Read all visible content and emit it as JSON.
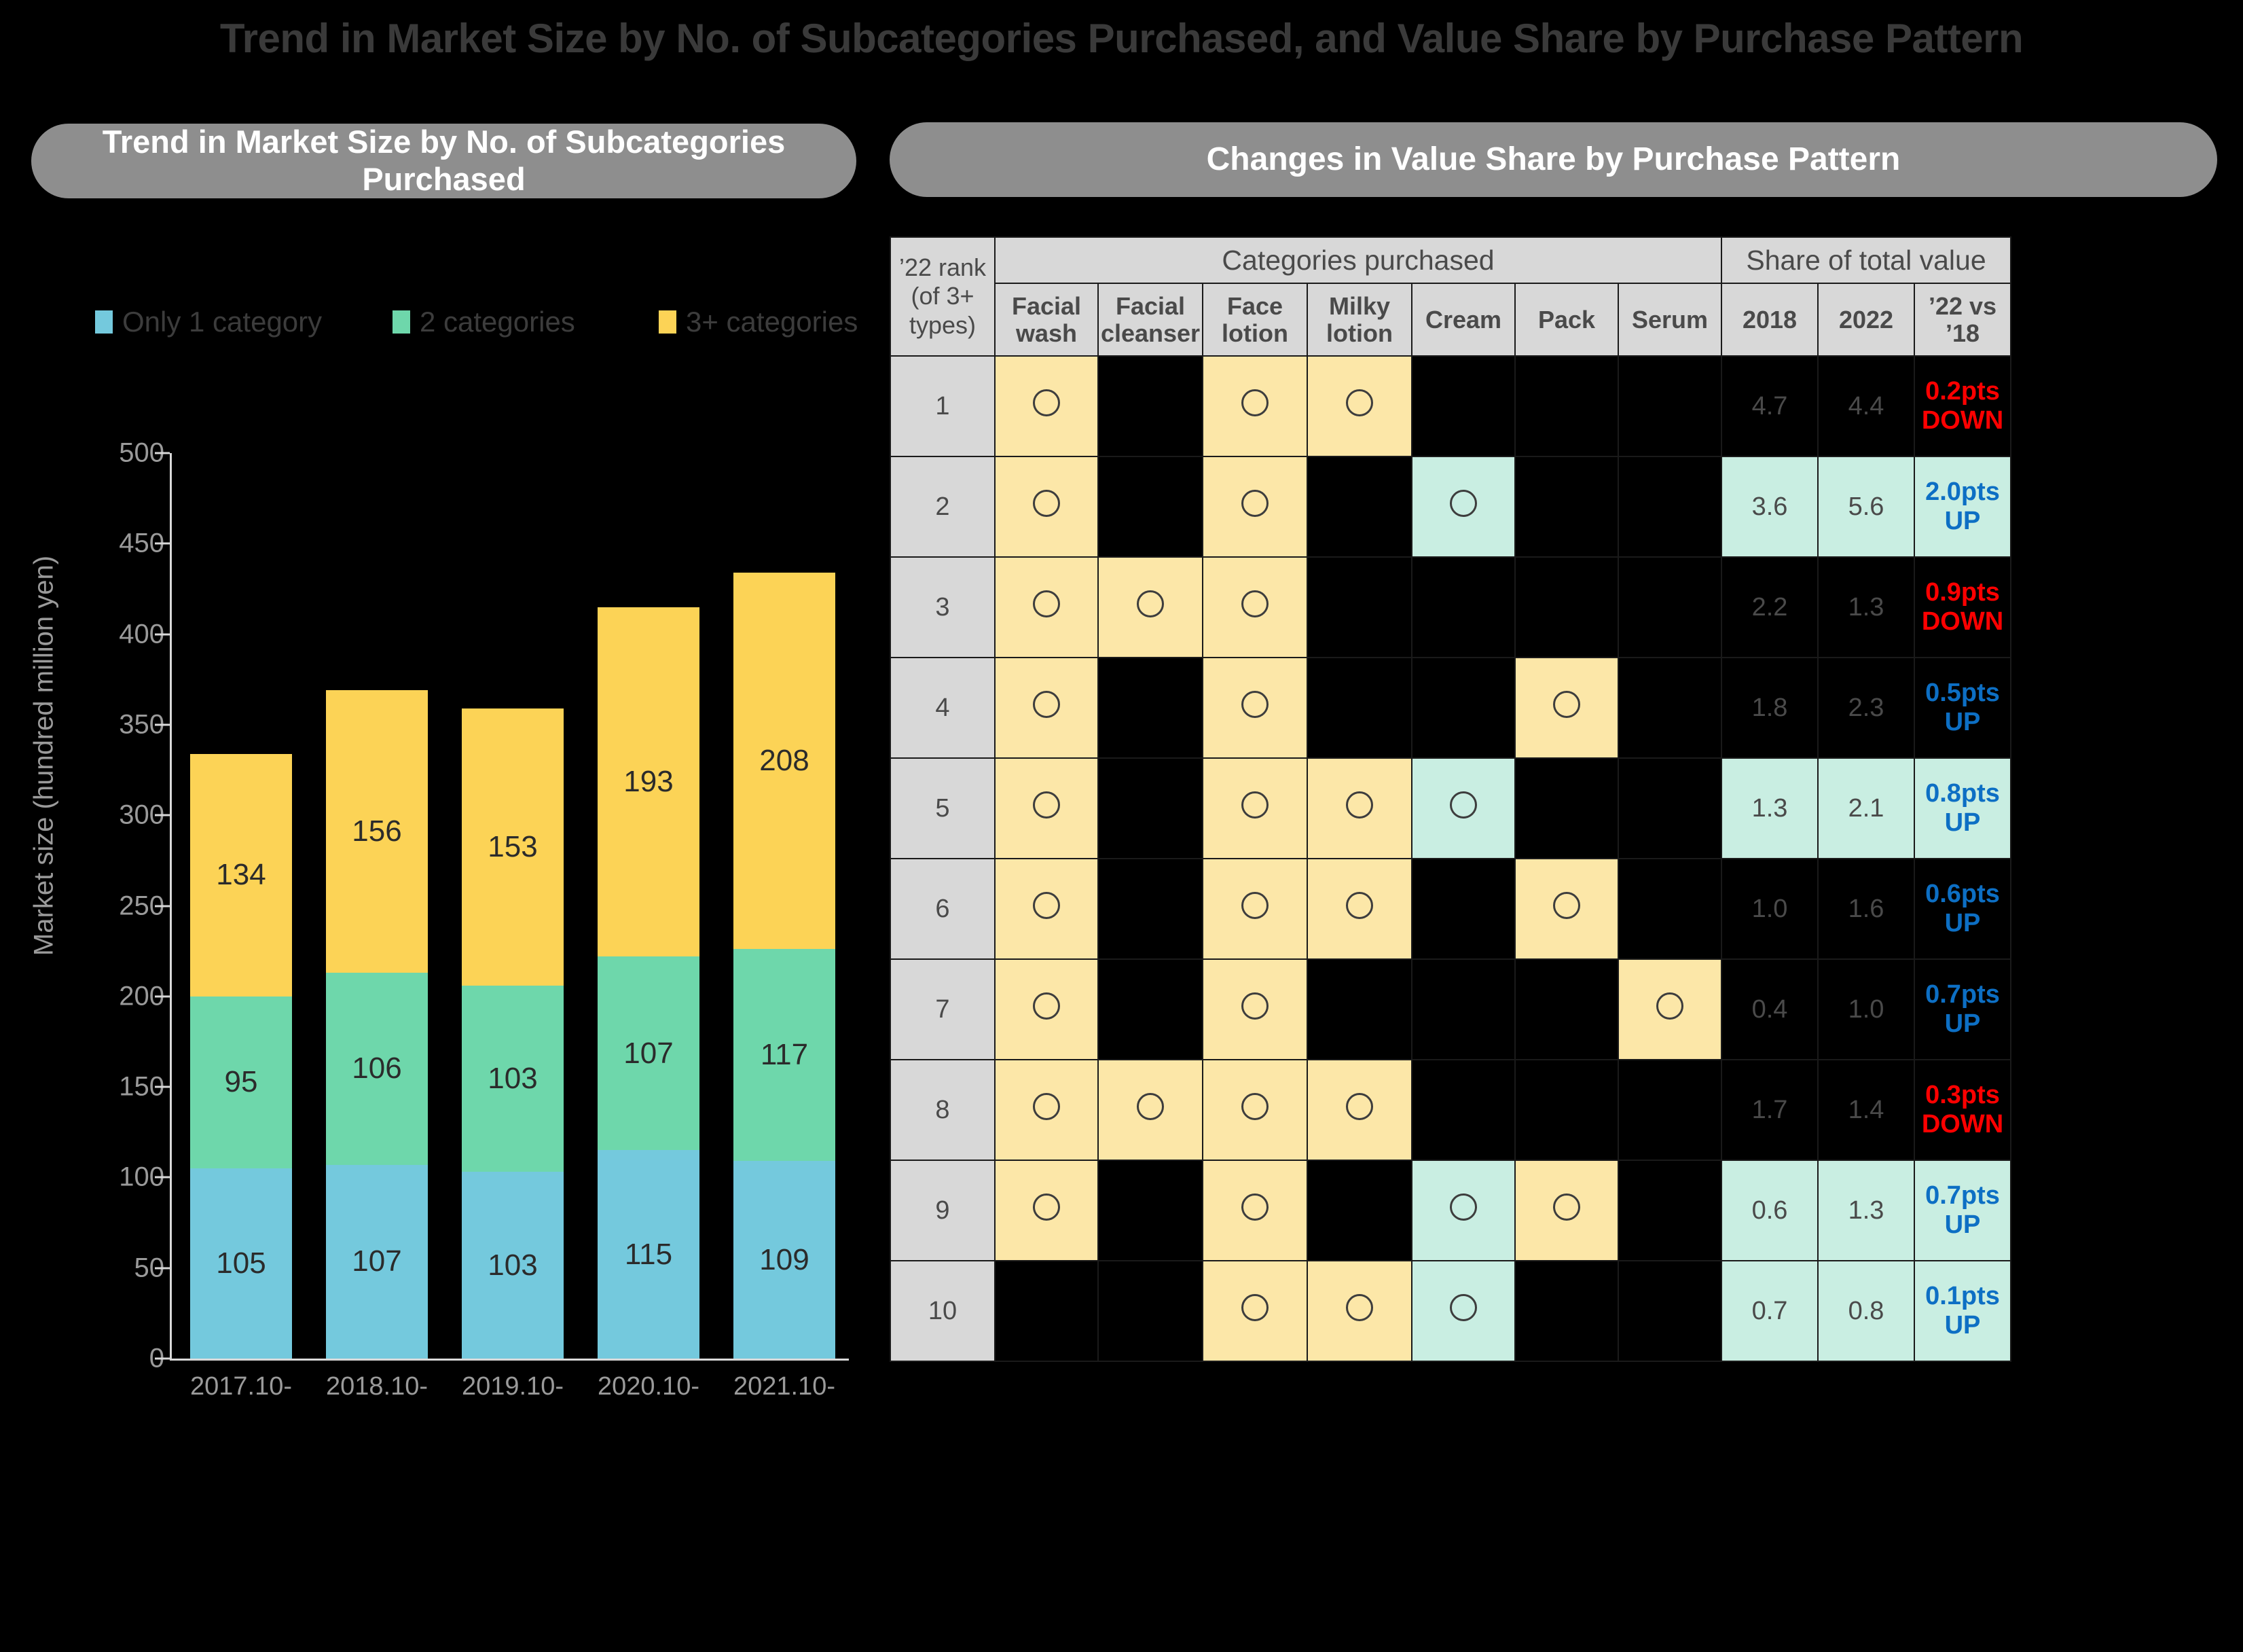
{
  "main_title": "Trend in Market Size by No. of Subcategories Purchased, and Value Share by Purchase Pattern",
  "panels": {
    "left_title": "Trend in Market Size by No. of Subcategories Purchased",
    "right_title": "Changes in Value Share by Purchase Pattern"
  },
  "colors": {
    "only1": "#74c9dd",
    "two": "#6ed7ab",
    "threeplus": "#fcd356",
    "cell_yellow": "#fce7a8",
    "cell_mint": "#c9eee2",
    "header_gray": "#d8d8d8",
    "pill_gray": "#8e8e8e",
    "up": "#0d6fc4",
    "down": "#ff0000"
  },
  "chart_data": {
    "type": "bar",
    "stacked": true,
    "title": "Trend in Market Size by No. of Subcategories Purchased",
    "xlabel": "",
    "ylabel": "Market size (hundred million yen)",
    "ylim": [
      0,
      500
    ],
    "yticks": [
      0,
      50,
      100,
      150,
      200,
      250,
      300,
      350,
      400,
      450,
      500
    ],
    "grid": false,
    "legend_position": "top",
    "categories": [
      "2017.10-",
      "2018.10-",
      "2019.10-",
      "2020.10-",
      "2021.10-"
    ],
    "series": [
      {
        "name": "Only 1 category",
        "color": "#74c9dd",
        "values": [
          105,
          107,
          103,
          115,
          109
        ]
      },
      {
        "name": "2 categories",
        "color": "#6ed7ab",
        "values": [
          95,
          106,
          103,
          107,
          117
        ]
      },
      {
        "name": "3+ categories",
        "color": "#fcd356",
        "values": [
          134,
          156,
          153,
          193,
          208
        ]
      }
    ],
    "totals": [
      334,
      369,
      359,
      415,
      434
    ]
  },
  "table": {
    "group_headers": {
      "rank": "’22 rank\n(of 3+ types)",
      "rank_line1": "’22 rank",
      "rank_line2": "(of 3+",
      "rank_line3": "types)",
      "categories": "Categories purchased",
      "share": "Share of total value"
    },
    "columns": [
      {
        "key": "facial_wash",
        "line1": "Facial",
        "line2": "wash"
      },
      {
        "key": "facial_cleanser",
        "line1": "Facial",
        "line2": "cleanser"
      },
      {
        "key": "face_lotion",
        "line1": "Face",
        "line2": "lotion"
      },
      {
        "key": "milky_lotion",
        "line1": "Milky",
        "line2": "lotion"
      },
      {
        "key": "cream",
        "line1": "Cream",
        "line2": ""
      },
      {
        "key": "pack",
        "line1": "Pack",
        "line2": ""
      },
      {
        "key": "serum",
        "line1": "Serum",
        "line2": ""
      }
    ],
    "share_columns": [
      {
        "key": "y2018",
        "label": "2018"
      },
      {
        "key": "y2022",
        "label": "2022"
      },
      {
        "key": "delta",
        "line1": "’22 vs",
        "line2": "’18"
      }
    ],
    "rows": [
      {
        "rank": "1",
        "marks": [
          1,
          0,
          1,
          1,
          0,
          0,
          0
        ],
        "y2018": "4.7",
        "y2022": "4.4",
        "delta_value": "0.2pts",
        "delta_dir": "DOWN",
        "highlight": false
      },
      {
        "rank": "2",
        "marks": [
          1,
          0,
          1,
          0,
          1,
          0,
          0
        ],
        "y2018": "3.6",
        "y2022": "5.6",
        "delta_value": "2.0pts",
        "delta_dir": "UP",
        "highlight": true
      },
      {
        "rank": "3",
        "marks": [
          1,
          1,
          1,
          0,
          0,
          0,
          0
        ],
        "y2018": "2.2",
        "y2022": "1.3",
        "delta_value": "0.9pts",
        "delta_dir": "DOWN",
        "highlight": false
      },
      {
        "rank": "4",
        "marks": [
          1,
          0,
          1,
          0,
          0,
          1,
          0
        ],
        "y2018": "1.8",
        "y2022": "2.3",
        "delta_value": "0.5pts",
        "delta_dir": "UP",
        "highlight": false
      },
      {
        "rank": "5",
        "marks": [
          1,
          0,
          1,
          1,
          1,
          0,
          0
        ],
        "y2018": "1.3",
        "y2022": "2.1",
        "delta_value": "0.8pts",
        "delta_dir": "UP",
        "highlight": true
      },
      {
        "rank": "6",
        "marks": [
          1,
          0,
          1,
          1,
          0,
          1,
          0
        ],
        "y2018": "1.0",
        "y2022": "1.6",
        "delta_value": "0.6pts",
        "delta_dir": "UP",
        "highlight": false
      },
      {
        "rank": "7",
        "marks": [
          1,
          0,
          1,
          0,
          0,
          0,
          1
        ],
        "y2018": "0.4",
        "y2022": "1.0",
        "delta_value": "0.7pts",
        "delta_dir": "UP",
        "highlight": false
      },
      {
        "rank": "8",
        "marks": [
          1,
          1,
          1,
          1,
          0,
          0,
          0
        ],
        "y2018": "1.7",
        "y2022": "1.4",
        "delta_value": "0.3pts",
        "delta_dir": "DOWN",
        "highlight": false
      },
      {
        "rank": "9",
        "marks": [
          1,
          0,
          1,
          0,
          1,
          1,
          0
        ],
        "y2018": "0.6",
        "y2022": "1.3",
        "delta_value": "0.7pts",
        "delta_dir": "UP",
        "highlight": true
      },
      {
        "rank": "10",
        "marks": [
          0,
          0,
          1,
          1,
          1,
          0,
          0
        ],
        "y2018": "0.7",
        "y2022": "0.8",
        "delta_value": "0.1pts",
        "delta_dir": "UP",
        "highlight": true
      }
    ]
  }
}
